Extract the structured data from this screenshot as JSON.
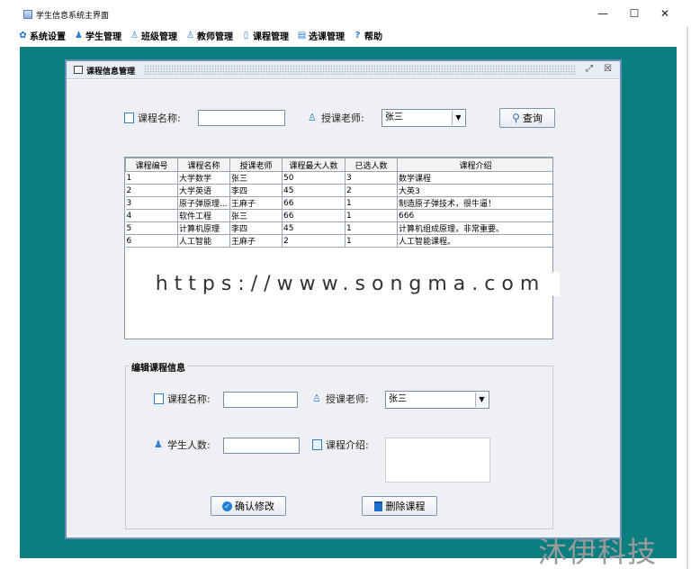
{
  "window": {
    "title": "学生信息系统主界面",
    "controls": [
      "—",
      "☐",
      "✕"
    ]
  },
  "menubar": {
    "items": [
      {
        "label": "系统设置",
        "icon": "gear-icon"
      },
      {
        "label": "学生管理",
        "icon": "student-icon"
      },
      {
        "label": "班级管理",
        "icon": "class-icon"
      },
      {
        "label": "教师管理",
        "icon": "teacher-icon"
      },
      {
        "label": "课程管理",
        "icon": "course-icon"
      },
      {
        "label": "选课管理",
        "icon": "select-course-icon"
      },
      {
        "label": "帮助",
        "icon": "help-icon"
      }
    ]
  },
  "frame": {
    "title": "课程信息管理"
  },
  "search": {
    "course_name_label": "课程名称:",
    "course_name_value": "",
    "teacher_label": "授课老师:",
    "teacher_selected": "张三",
    "query_button": "查询"
  },
  "table": {
    "headers": [
      "课程编号",
      "课程名称",
      "授课老师",
      "课程最大人数",
      "已选人数",
      "课程介绍"
    ],
    "rows": [
      [
        "1",
        "大学数学",
        "张三",
        "50",
        "3",
        "数学课程"
      ],
      [
        "2",
        "大学英语",
        "李四",
        "45",
        "2",
        "大英3"
      ],
      [
        "3",
        "原子弹原理...",
        "王麻子",
        "66",
        "1",
        "制造原子弹技术，很牛逼！"
      ],
      [
        "4",
        "软件工程",
        "张三",
        "66",
        "1",
        "666"
      ],
      [
        "5",
        "计算机原理",
        "李四",
        "45",
        "1",
        "计算机组成原理，非常重要。"
      ],
      [
        "6",
        "人工智能",
        "王麻子",
        "2",
        "1",
        "人工智能课程。"
      ]
    ]
  },
  "watermark": {
    "url": "https://www.songma.com",
    "brand": "沐伊科技"
  },
  "edit": {
    "group_title": "编辑课程信息",
    "course_name_label": "课程名称:",
    "course_name_value": "",
    "teacher_label": "授课老师:",
    "teacher_selected": "张三",
    "student_count_label": "学生人数:",
    "student_count_value": "",
    "intro_label": "课程介绍:",
    "intro_value": "",
    "confirm_button": "确认修改",
    "delete_button": "删除课程"
  }
}
